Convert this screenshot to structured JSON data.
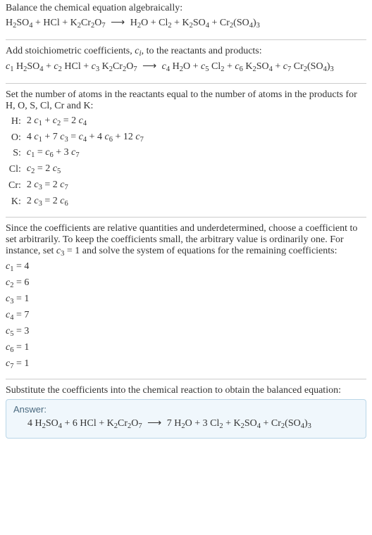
{
  "sec1": {
    "caption": "Balance the chemical equation algebraically:",
    "eq_lhs": "H₂SO₄ + HCl + K₂Cr₂O₇",
    "eq_rhs": "H₂O + Cl₂ + K₂SO₄ + Cr₂(SO₄)₃",
    "arrow": "⟶"
  },
  "sec2": {
    "caption_a": "Add stoichiometric coefficients, ",
    "caption_b": ", to the reactants and products:",
    "ci_var": "c",
    "ci_sub": "i",
    "lhs": "c₁ H₂SO₄ + c₂ HCl + c₃ K₂Cr₂O₇",
    "rhs": "c₄ H₂O + c₅ Cl₂ + c₆ K₂SO₄ + c₇ Cr₂(SO₄)₃",
    "arrow": "⟶"
  },
  "sec3": {
    "caption": "Set the number of atoms in the reactants equal to the number of atoms in the products for H, O, S, Cl, Cr and K:",
    "rows": [
      {
        "el": "H:",
        "eq": "2 c₁ + c₂ = 2 c₄"
      },
      {
        "el": "O:",
        "eq": "4 c₁ + 7 c₃ = c₄ + 4 c₆ + 12 c₇"
      },
      {
        "el": "S:",
        "eq": "c₁ = c₆ + 3 c₇"
      },
      {
        "el": "Cl:",
        "eq": "c₂ = 2 c₅"
      },
      {
        "el": "Cr:",
        "eq": "2 c₃ = 2 c₇"
      },
      {
        "el": "K:",
        "eq": "2 c₃ = 2 c₆"
      }
    ]
  },
  "sec4": {
    "caption": "Since the coefficients are relative quantities and underdetermined, choose a coefficient to set arbitrarily. To keep the coefficients small, the arbitrary value is ordinarily one. For instance, set c₃ = 1 and solve the system of equations for the remaining coefficients:",
    "coeffs": [
      "c₁ = 4",
      "c₂ = 6",
      "c₃ = 1",
      "c₄ = 7",
      "c₅ = 3",
      "c₆ = 1",
      "c₇ = 1"
    ]
  },
  "sec5": {
    "caption": "Substitute the coefficients into the chemical reaction to obtain the balanced equation:",
    "answer_label": "Answer:",
    "answer_eq_lhs": "4 H₂SO₄ + 6 HCl + K₂Cr₂O₇",
    "answer_eq_rhs": "7 H₂O + 3 Cl₂ + K₂SO₄ + Cr₂(SO₄)₃",
    "arrow": "⟶"
  }
}
